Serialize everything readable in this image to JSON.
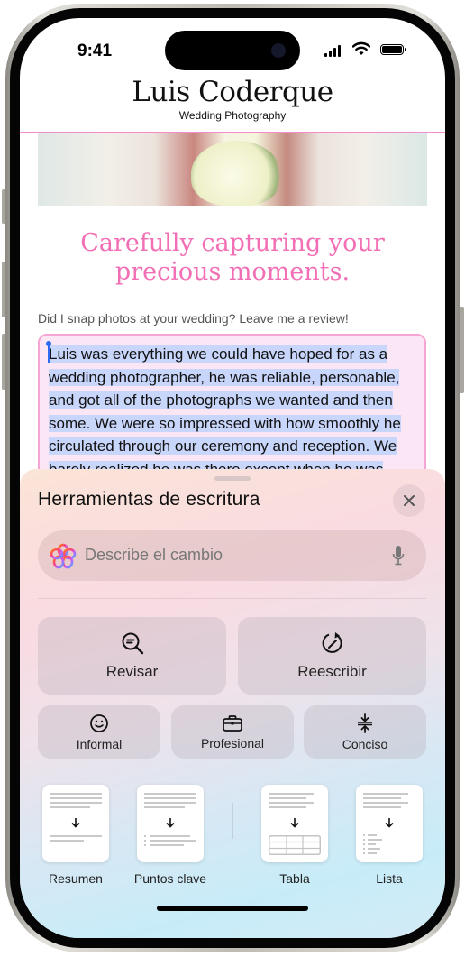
{
  "status_bar": {
    "time": "9:41"
  },
  "site": {
    "title": "Luis Coderque",
    "subtitle": "Wedding Photography",
    "tagline_line1": "Carefully capturing your",
    "tagline_line2": "precious moments.",
    "review_prompt": "Did I snap photos at your wedding? Leave me a review!",
    "review_text": "Luis was everything we could have hoped for as a wedding photographer, he was reliable, personable, and got all of the photographs we wanted and then some. We were so impressed with how smoothly he circulated through our ceremony and reception. We barely realized he was there except when he was very",
    "colors": {
      "accent": "#f26fb5",
      "selection": "#c9d6fb",
      "caret": "#2a6bf2"
    }
  },
  "writing_tools": {
    "title": "Herramientas de escritura",
    "close_icon": "close-icon",
    "input": {
      "placeholder": "Describe el cambio",
      "value": ""
    },
    "actions": [
      {
        "label": "Revisar",
        "icon": "proofread-icon"
      },
      {
        "label": "Reescribir",
        "icon": "rewrite-icon"
      }
    ],
    "tones": [
      {
        "label": "Informal",
        "icon": "smiley-icon"
      },
      {
        "label": "Profesional",
        "icon": "briefcase-icon"
      },
      {
        "label": "Conciso",
        "icon": "compress-icon"
      }
    ],
    "formats": [
      {
        "label": "Resumen",
        "icon": "summary-doc-icon"
      },
      {
        "label": "Puntos clave",
        "icon": "key-points-doc-icon"
      },
      {
        "label": "Tabla",
        "icon": "table-doc-icon"
      },
      {
        "label": "Lista",
        "icon": "list-doc-icon"
      }
    ]
  }
}
